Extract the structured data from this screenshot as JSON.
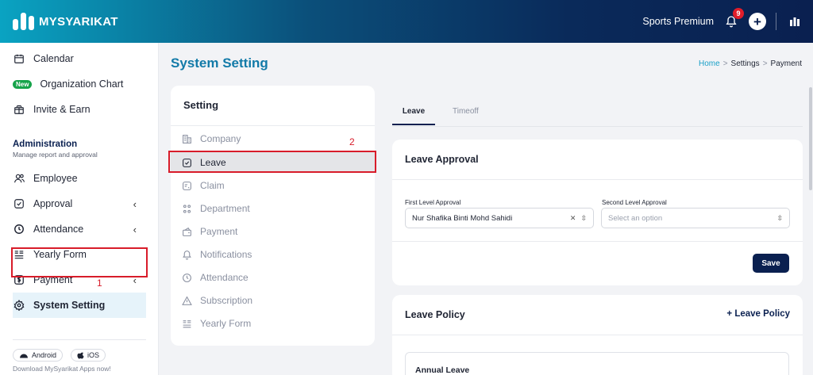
{
  "header": {
    "logo_text": "MYSYARIKAT",
    "plan": "Sports Premium",
    "notification_count": "9",
    "add_label": "+"
  },
  "sidebar": {
    "top_items": [
      {
        "label": "Calendar",
        "icon": "calendar-icon"
      },
      {
        "label": "Organization Chart",
        "icon": "new-badge",
        "badge": "New"
      },
      {
        "label": "Invite & Earn",
        "icon": "gift-icon"
      }
    ],
    "section_title": "Administration",
    "section_subtitle": "Manage report and approval",
    "admin_items": [
      {
        "label": "Employee",
        "icon": "users-icon"
      },
      {
        "label": "Approval",
        "icon": "check-square-icon",
        "chevron": "‹"
      },
      {
        "label": "Attendance",
        "icon": "clock-icon",
        "chevron": "‹"
      },
      {
        "label": "Yearly Form",
        "icon": "form-icon"
      },
      {
        "label": "Payment",
        "icon": "dollar-icon",
        "chevron": "‹"
      },
      {
        "label": "System Setting",
        "icon": "gear-icon",
        "active": true
      }
    ],
    "annotation_1": "1",
    "store_android": "Android",
    "store_ios": "iOS",
    "download_text": "Download MySyarikat Apps now!"
  },
  "main": {
    "title": "System Setting",
    "breadcrumb": [
      "Home",
      "Settings",
      "Payment"
    ],
    "breadcrumb_sep": ">",
    "setting_menu": {
      "title": "Setting",
      "annotation_2": "2",
      "items": [
        {
          "label": "Company",
          "icon": "building-icon"
        },
        {
          "label": "Leave",
          "icon": "check-square-icon",
          "active": true
        },
        {
          "label": "Claim",
          "icon": "receipt-icon"
        },
        {
          "label": "Department",
          "icon": "org-icon"
        },
        {
          "label": "Payment",
          "icon": "wallet-icon"
        },
        {
          "label": "Notifications",
          "icon": "bell-icon"
        },
        {
          "label": "Attendance",
          "icon": "clock-icon"
        },
        {
          "label": "Subscription",
          "icon": "warning-icon"
        },
        {
          "label": "Yearly Form",
          "icon": "form-icon"
        }
      ]
    },
    "tabs": [
      {
        "label": "Leave",
        "active": true
      },
      {
        "label": "Timeoff",
        "active": false
      }
    ],
    "leave_approval": {
      "title": "Leave Approval",
      "first_label": "First Level Approval",
      "first_value": "Nur Shafika Binti Mohd Sahidi",
      "second_label": "Second Level Approval",
      "second_placeholder": "Select an option",
      "save_label": "Save"
    },
    "leave_policy": {
      "title": "Leave Policy",
      "add_label": "+ Leave Policy",
      "inner_title": "Annual Leave"
    }
  },
  "colors": {
    "brand_navy": "#0a2050",
    "brand_cyan": "#0aa3c2",
    "annotation_red": "#d81c2a",
    "title_blue": "#127aa8"
  }
}
